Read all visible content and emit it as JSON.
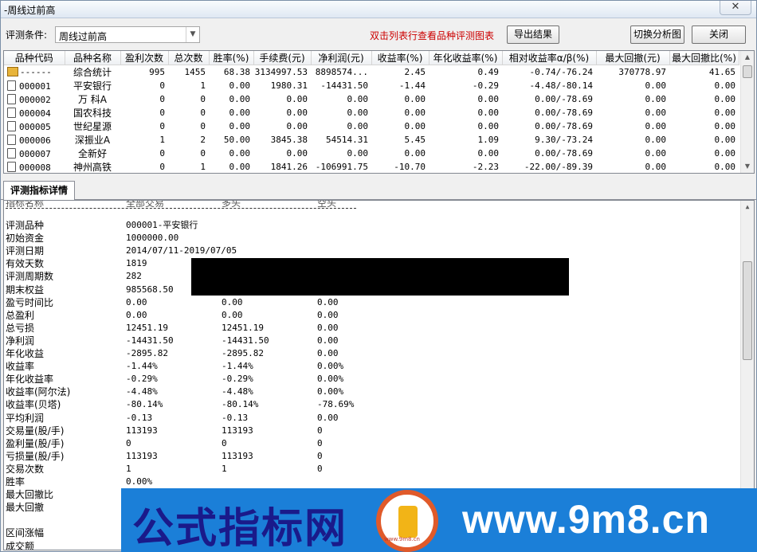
{
  "window": {
    "title": "-周线过前高",
    "close_label": "✕"
  },
  "toolbar": {
    "condition_label": "评测条件:",
    "condition_value": "周线过前高",
    "hint": "双击列表行查看品种评测图表",
    "export_label": "导出结果",
    "switch_label": "切换分析图",
    "close_label": "关闭"
  },
  "grid": {
    "columns": [
      "品种代码",
      "品种名称",
      "盈利次数",
      "总次数",
      "胜率(%)",
      "手续费(元)",
      "净利润(元)",
      "收益率(%)",
      "年化收益率(%)",
      "相对收益率α/β(%)",
      "最大回撤(元)",
      "最大回撤比(%)"
    ],
    "rows": [
      [
        "------",
        "综合统计",
        "995",
        "1455",
        "68.38",
        "3134997.53",
        "8898574...",
        "2.45",
        "0.49",
        "-0.74/-76.24",
        "370778.97",
        "41.65"
      ],
      [
        "000001",
        "平安银行",
        "0",
        "1",
        "0.00",
        "1980.31",
        "-14431.50",
        "-1.44",
        "-0.29",
        "-4.48/-80.14",
        "0.00",
        "0.00"
      ],
      [
        "000002",
        "万 科A",
        "0",
        "0",
        "0.00",
        "0.00",
        "0.00",
        "0.00",
        "0.00",
        "0.00/-78.69",
        "0.00",
        "0.00"
      ],
      [
        "000004",
        "国农科技",
        "0",
        "0",
        "0.00",
        "0.00",
        "0.00",
        "0.00",
        "0.00",
        "0.00/-78.69",
        "0.00",
        "0.00"
      ],
      [
        "000005",
        "世纪星源",
        "0",
        "0",
        "0.00",
        "0.00",
        "0.00",
        "0.00",
        "0.00",
        "0.00/-78.69",
        "0.00",
        "0.00"
      ],
      [
        "000006",
        "深振业A",
        "1",
        "2",
        "50.00",
        "3845.38",
        "54514.31",
        "5.45",
        "1.09",
        "9.30/-73.24",
        "0.00",
        "0.00"
      ],
      [
        "000007",
        "全新好",
        "0",
        "0",
        "0.00",
        "0.00",
        "0.00",
        "0.00",
        "0.00",
        "0.00/-78.69",
        "0.00",
        "0.00"
      ],
      [
        "000008",
        "神州高铁",
        "0",
        "1",
        "0.00",
        "1841.26",
        "-106991.75",
        "-10.70",
        "-2.23",
        "-22.00/-89.39",
        "0.00",
        "0.00"
      ]
    ]
  },
  "tab": {
    "label": "评测指标详情"
  },
  "detail": {
    "ghost_header": [
      "指标名称",
      "全部交易",
      "多头",
      "空头"
    ],
    "rows": [
      [
        "评测品种",
        "000001-平安银行",
        "",
        ""
      ],
      [
        "初始资金",
        "1000000.00",
        "",
        ""
      ],
      [
        "评测日期",
        "2014/07/11-2019/07/05",
        "",
        ""
      ],
      [
        "有效天数",
        "1819",
        "",
        ""
      ],
      [
        "评测周期数",
        "282",
        "",
        ""
      ],
      [
        "期末权益",
        "985568.50",
        "",
        ""
      ],
      [
        "盈亏时间比",
        "0.00",
        "0.00",
        "0.00"
      ],
      [
        "总盈利",
        "0.00",
        "0.00",
        "0.00"
      ],
      [
        "总亏损",
        "12451.19",
        "12451.19",
        "0.00"
      ],
      [
        "净利润",
        "-14431.50",
        "-14431.50",
        "0.00"
      ],
      [
        "年化收益",
        "-2895.82",
        "-2895.82",
        "0.00"
      ],
      [
        "收益率",
        "-1.44%",
        "-1.44%",
        "0.00%"
      ],
      [
        "年化收益率",
        "-0.29%",
        "-0.29%",
        "0.00%"
      ],
      [
        "收益率(阿尔法)",
        "-4.48%",
        "-4.48%",
        "0.00%"
      ],
      [
        "收益率(贝塔)",
        "-80.14%",
        "-80.14%",
        "-78.69%"
      ],
      [
        "平均利润",
        "-0.13",
        "-0.13",
        "0.00"
      ],
      [
        "交易量(股/手)",
        "113193",
        "113193",
        "0"
      ],
      [
        "盈利量(股/手)",
        "0",
        "0",
        "0"
      ],
      [
        "亏损量(股/手)",
        "113193",
        "113193",
        "0"
      ],
      [
        "交易次数",
        "1",
        "1",
        "0"
      ],
      [
        "胜率",
        "0.00%",
        "",
        ""
      ],
      [
        "最大回撤比",
        "",
        "",
        ""
      ],
      [
        "最大回撤",
        "",
        "",
        ""
      ],
      [
        "",
        "",
        "",
        ""
      ],
      [
        "区间涨幅",
        "",
        "",
        ""
      ],
      [
        "成交额",
        "",
        "",
        ""
      ]
    ]
  },
  "watermark": {
    "cn": "公式指标网",
    "url": "www.9m8.cn",
    "logo_text": "www.9m8.cn"
  }
}
